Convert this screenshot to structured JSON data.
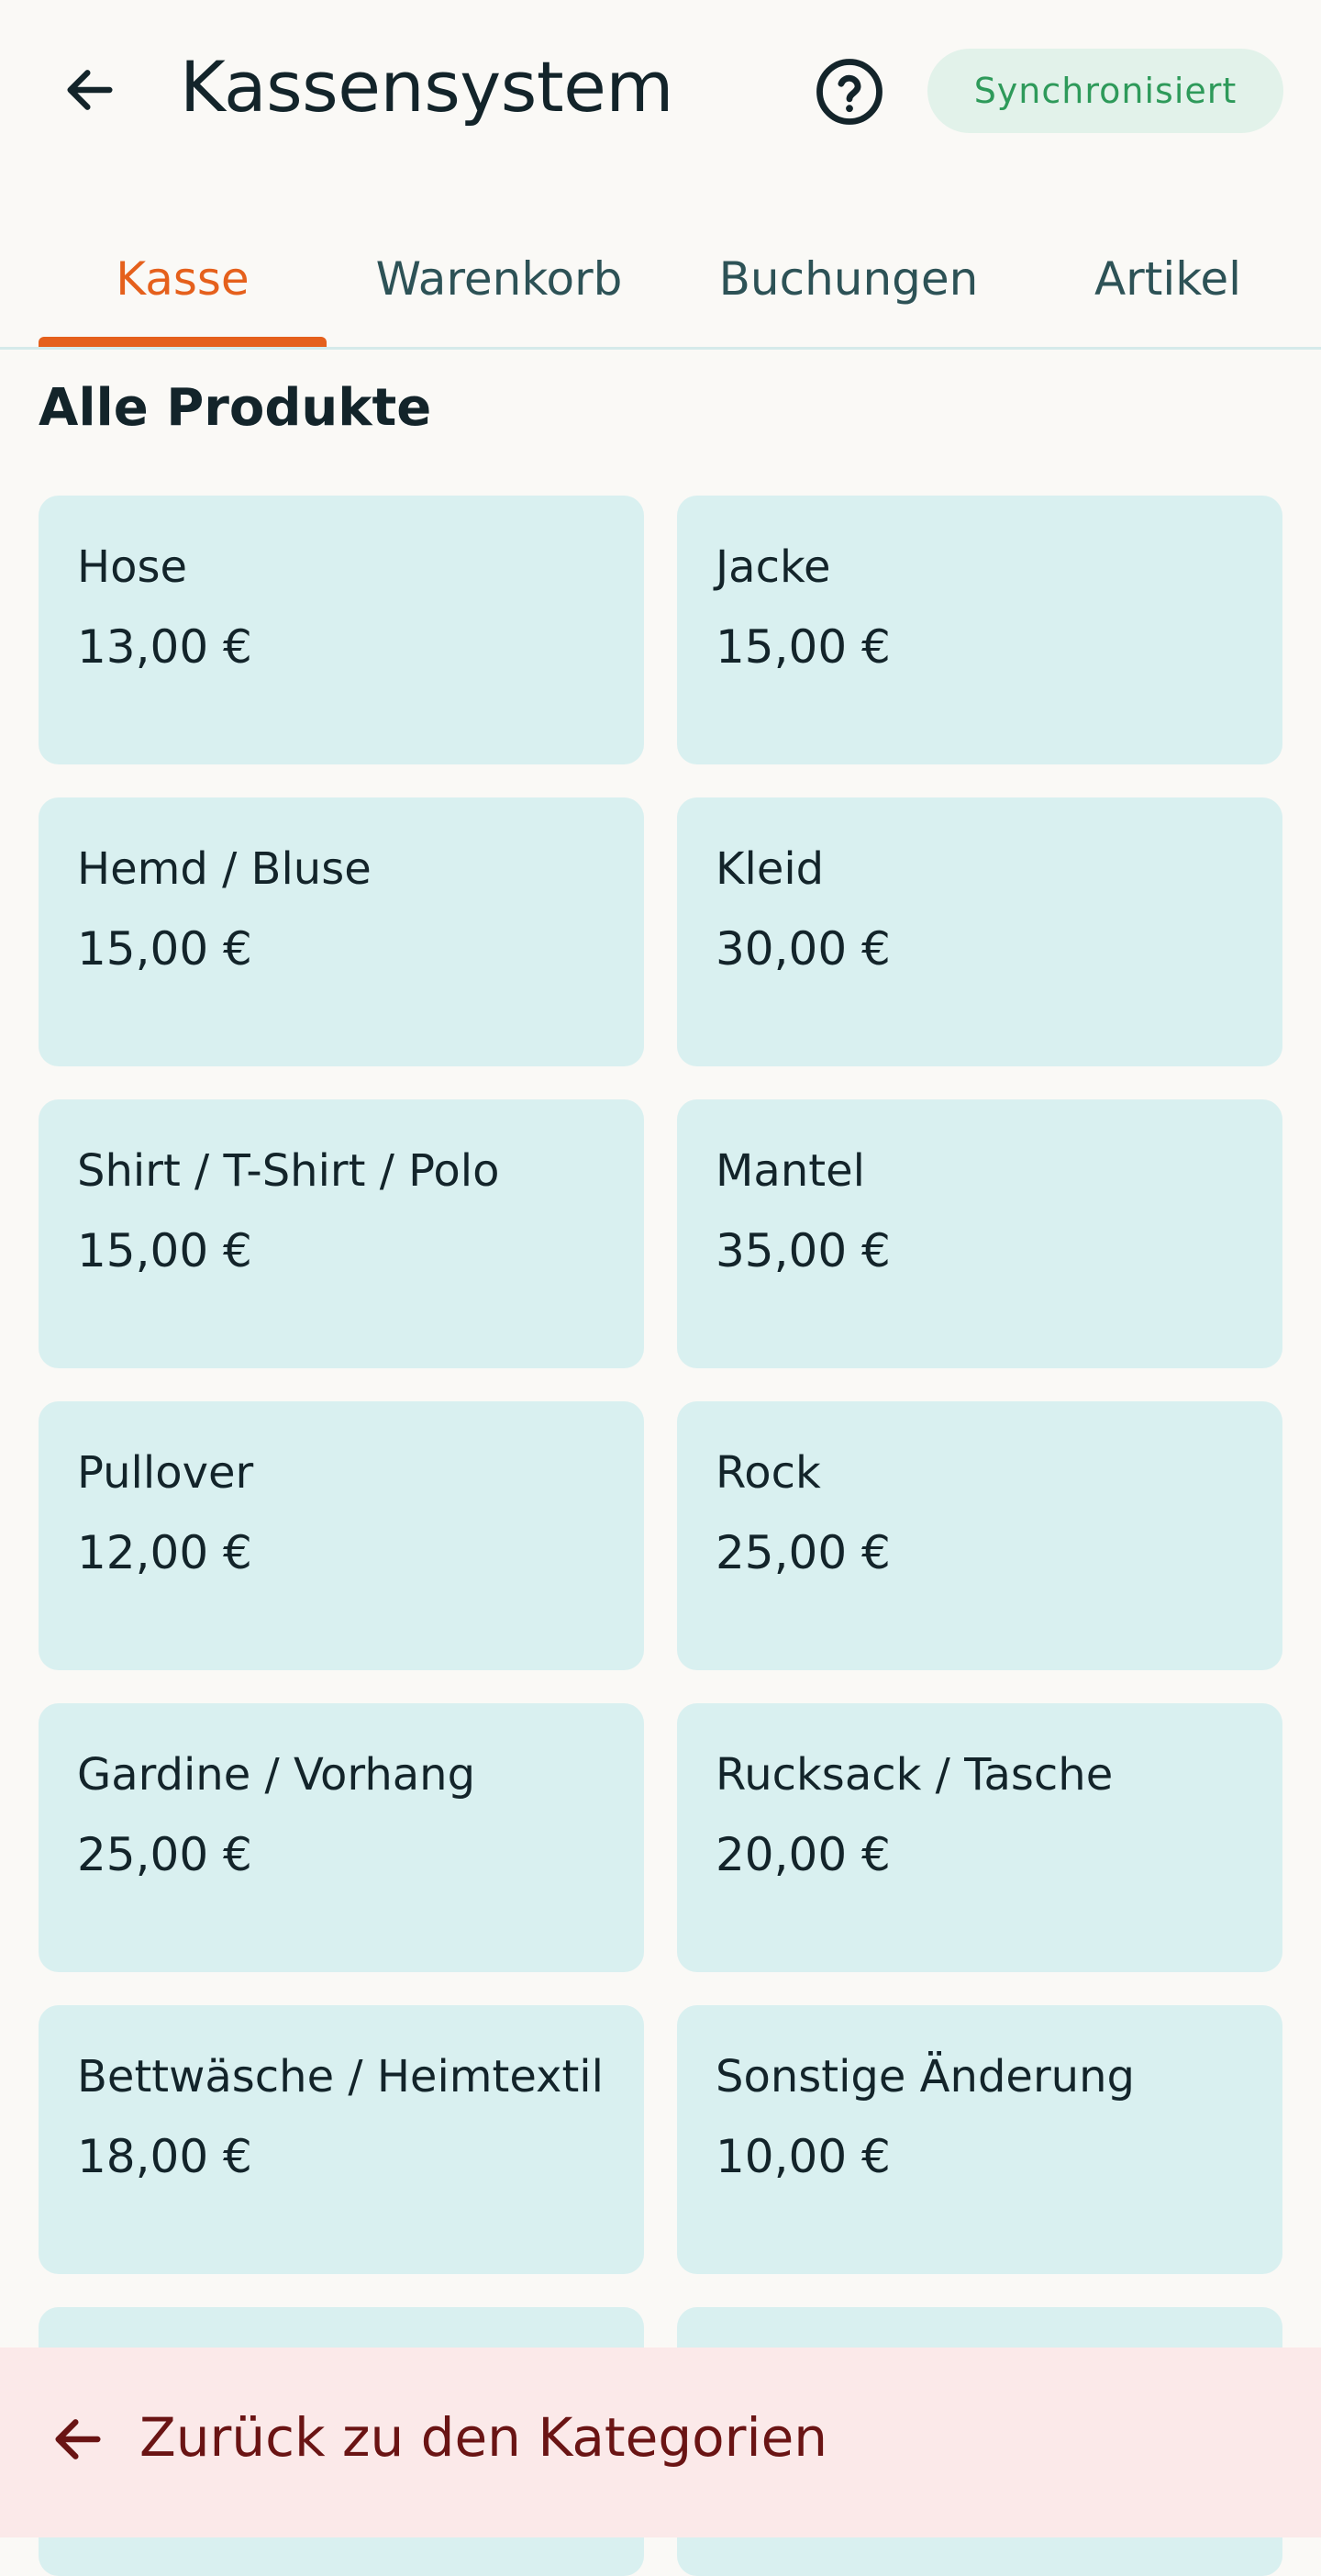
{
  "header": {
    "back_icon": "arrow-left-icon",
    "title": "Kassensystem",
    "help_icon": "question-circle-icon",
    "sync_status": "Synchronisiert"
  },
  "tabs": [
    {
      "label": "Kasse",
      "active": true
    },
    {
      "label": "Warenkorb",
      "active": false
    },
    {
      "label": "Buchungen",
      "active": false
    },
    {
      "label": "Artikel",
      "active": false
    }
  ],
  "section": {
    "title": "Alle Produkte"
  },
  "products": [
    {
      "name": "Hose",
      "price": "13,00 €"
    },
    {
      "name": "Jacke",
      "price": "15,00 €"
    },
    {
      "name": "Hemd / Bluse",
      "price": "15,00 €"
    },
    {
      "name": "Kleid",
      "price": "30,00 €"
    },
    {
      "name": "Shirt / T-Shirt / Polo",
      "price": "15,00 €"
    },
    {
      "name": "Mantel",
      "price": "35,00 €"
    },
    {
      "name": "Pullover",
      "price": "12,00 €"
    },
    {
      "name": "Rock",
      "price": "25,00 €"
    },
    {
      "name": "Gardine / Vorhang",
      "price": "25,00 €"
    },
    {
      "name": "Rucksack / Tasche",
      "price": "20,00 €"
    },
    {
      "name": "Bettwäsche / Heimtextil",
      "price": "18,00 €"
    },
    {
      "name": "Sonstige Änderung",
      "price": "10,00 €"
    },
    {
      "name": "",
      "price": ""
    },
    {
      "name": "",
      "price": ""
    }
  ],
  "footer": {
    "back_icon": "arrow-left-icon",
    "label": "Zurück zu den Kategorien"
  },
  "colors": {
    "accent": "#e5601c",
    "card_background": "#d9f0f0",
    "sync_badge_bg": "#e2f2ea",
    "sync_badge_text": "#2e9a5a",
    "footer_bg": "#fbe9e9",
    "footer_text": "#6a1414"
  }
}
